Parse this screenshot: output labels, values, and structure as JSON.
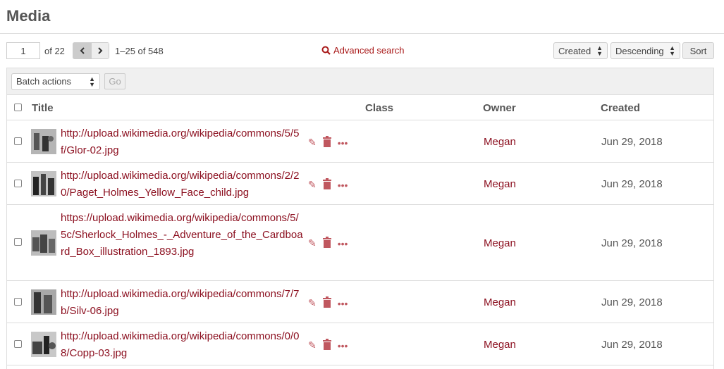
{
  "header": {
    "title": "Media"
  },
  "pager": {
    "current_page": "1",
    "of_text": "of 22",
    "prev_icon": "chevron-left-icon",
    "next_icon": "chevron-right-icon",
    "range": "1–25 of 548"
  },
  "search": {
    "advanced_label": "Advanced search",
    "icon": "search-icon"
  },
  "sort": {
    "by": "Created",
    "order": "Descending",
    "button": "Sort"
  },
  "batch": {
    "select": "Batch actions",
    "go": "Go"
  },
  "columns": {
    "title": "Title",
    "class": "Class",
    "owner": "Owner",
    "created": "Created"
  },
  "rows": [
    {
      "title": "http://upload.wikimedia.org/wikipedia/commons/5/5f/Glor-02.jpg",
      "owner": "Megan",
      "created": "Jun 29, 2018"
    },
    {
      "title": "http://upload.wikimedia.org/wikipedia/commons/2/20/Paget_Holmes_Yellow_Face_child.jpg",
      "owner": "Megan",
      "created": "Jun 29, 2018"
    },
    {
      "title": "https://upload.wikimedia.org/wikipedia/commons/5/5c/Sherlock_Holmes_-_Adventure_of_the_Cardboard_Box_illustration_1893.jpg",
      "owner": "Megan",
      "created": "Jun 29, 2018"
    },
    {
      "title": "http://upload.wikimedia.org/wikipedia/commons/7/7b/Silv-06.jpg",
      "owner": "Megan",
      "created": "Jun 29, 2018"
    },
    {
      "title": "http://upload.wikimedia.org/wikipedia/commons/0/08/Copp-03.jpg",
      "owner": "Megan",
      "created": "Jun 29, 2018"
    }
  ],
  "row_actions": {
    "edit_icon": "pencil-icon",
    "delete_icon": "trash-icon",
    "more_icon": "ellipsis-icon"
  },
  "colors": {
    "link": "#8b0e1e",
    "accent": "#a91919"
  }
}
